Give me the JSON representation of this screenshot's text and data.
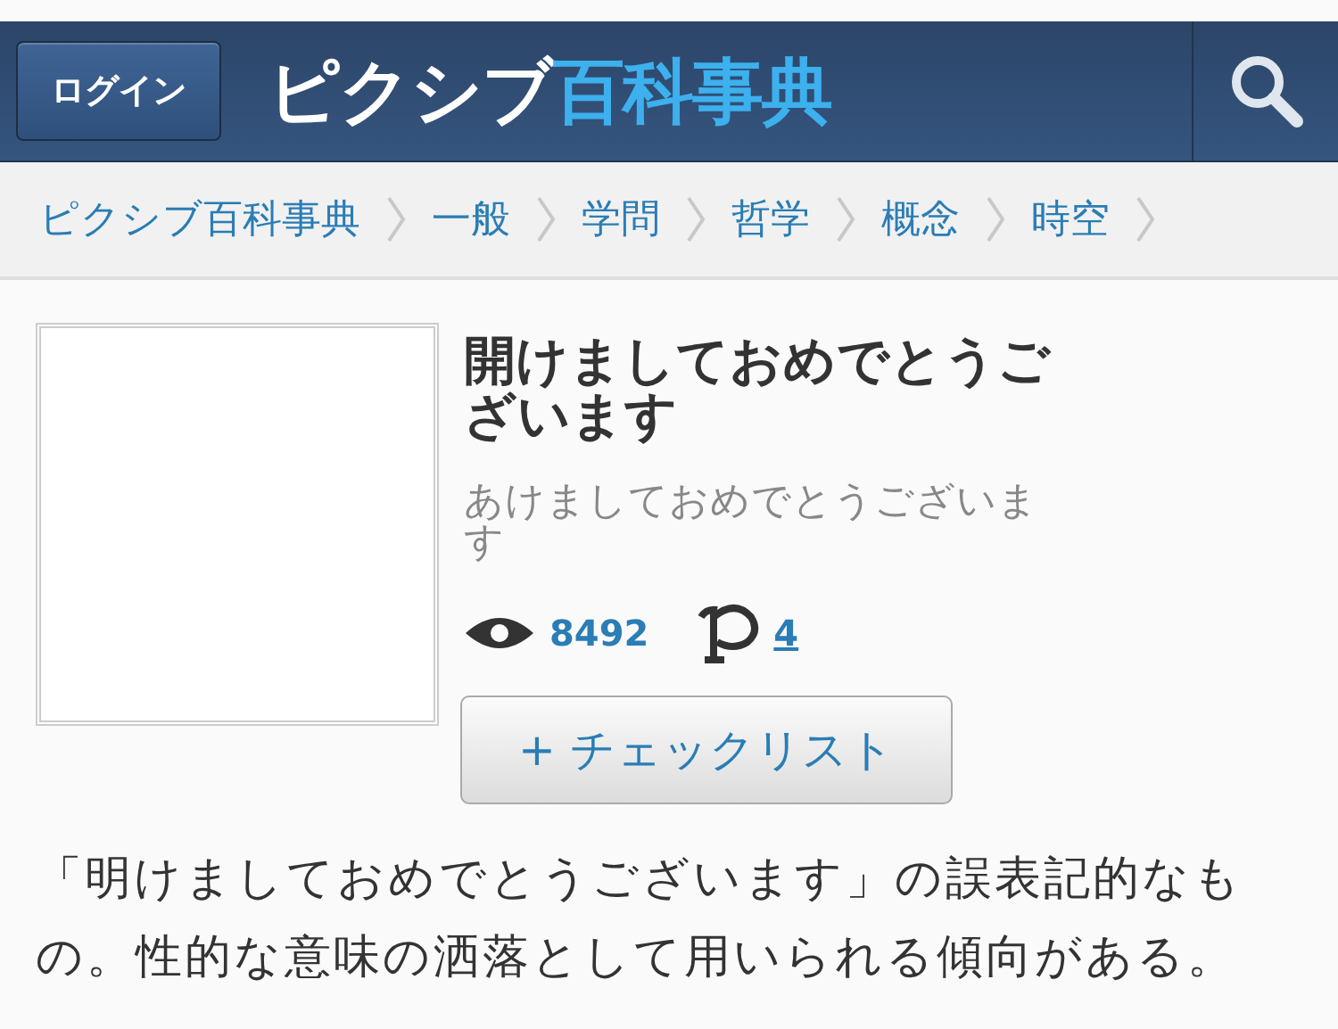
{
  "header": {
    "login_button": "ログイン",
    "logo_main": "ピクシブ",
    "logo_accent": "百科事典"
  },
  "breadcrumbs": [
    "ピクシブ百科事典",
    "一般",
    "学問",
    "哲学",
    "概念",
    "時空"
  ],
  "article": {
    "title": "開けましておめでとうございます",
    "reading": "あけましておめでとうございます",
    "views": "8492",
    "posts": "4",
    "checklist_button": "+ チェックリスト",
    "description": "「明けましておめでとうございます」の誤表記的なもの。性的な意味の洒落として用いられる傾向がある。"
  }
}
